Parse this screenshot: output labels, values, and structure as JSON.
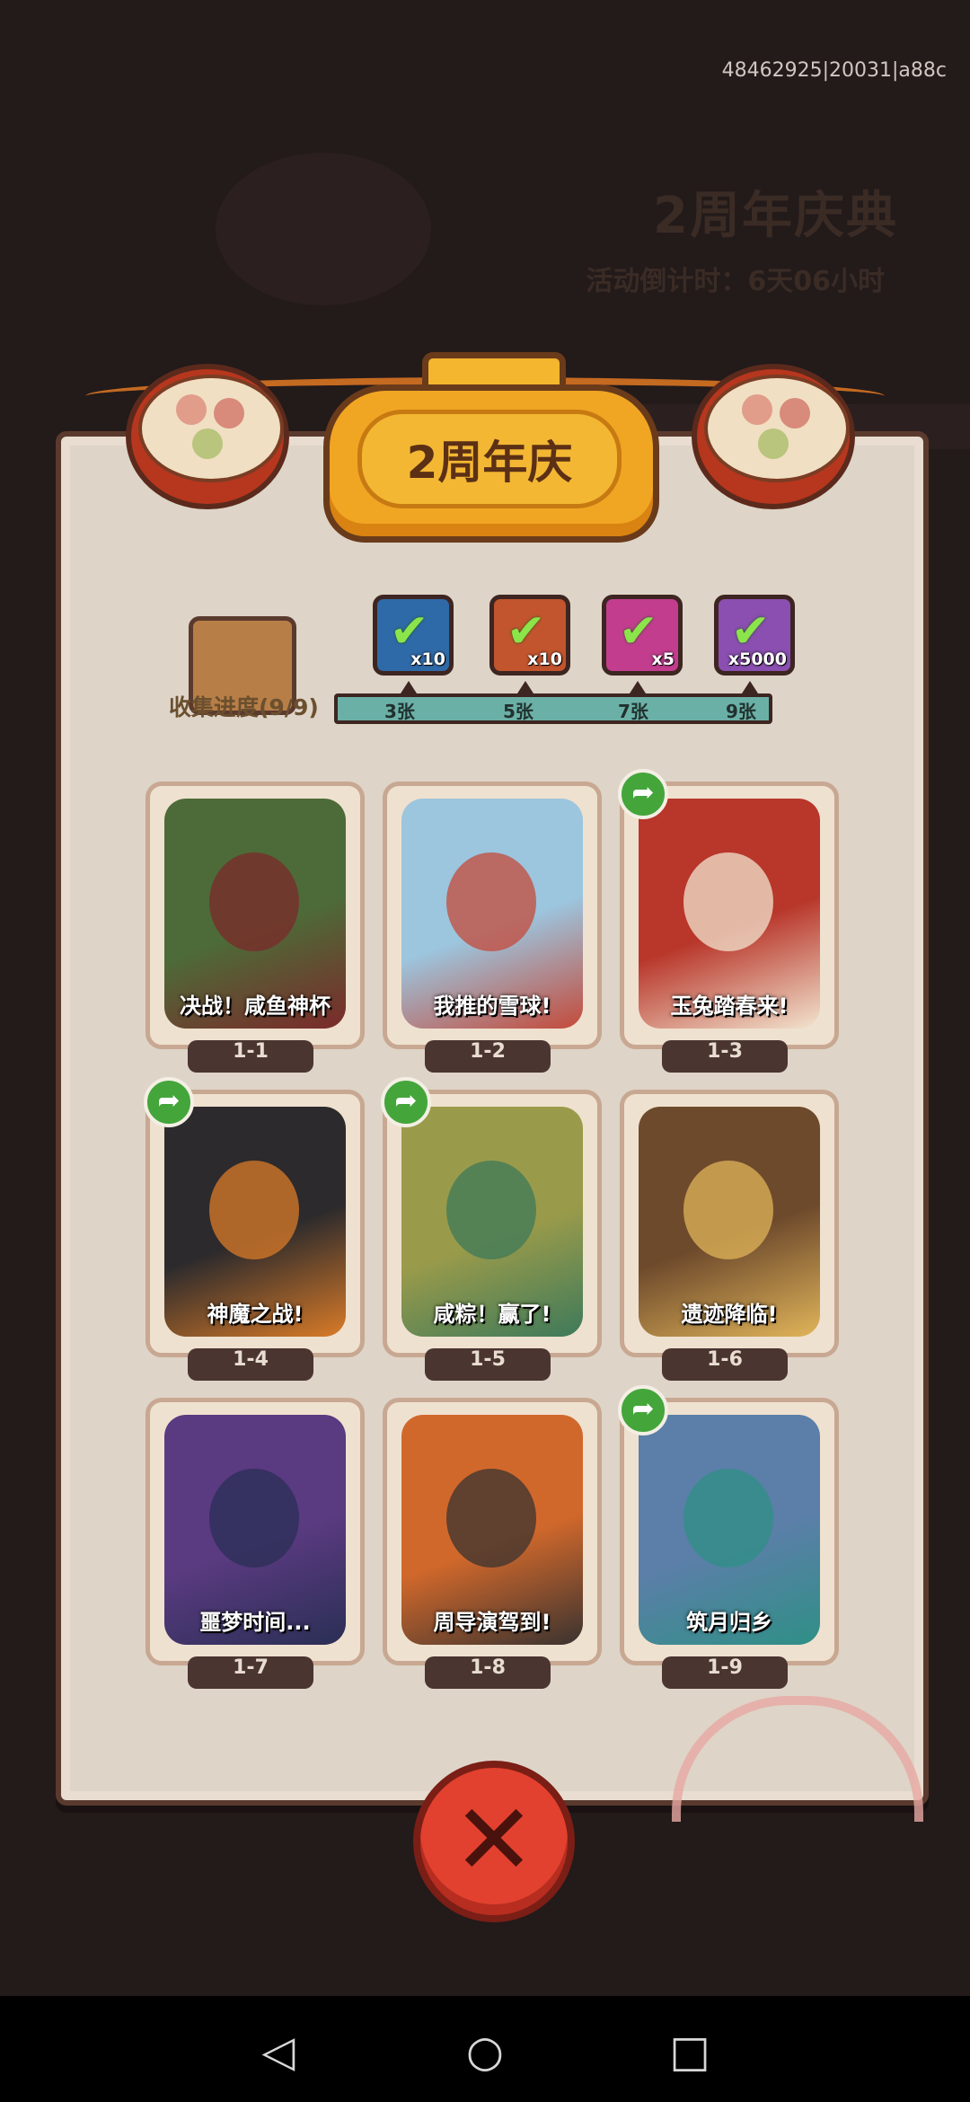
{
  "build_id": "48462925|20031|a88c",
  "background": {
    "event_title": "2周年庆典",
    "countdown": "活动倒计时：6天06小时"
  },
  "header": {
    "title": "2周年庆"
  },
  "collection": {
    "progress_label": "收集进度(9/9)",
    "collected": 9,
    "total": 9,
    "milestones": [
      {
        "threshold_label": "3张",
        "reward_icon": "treasure-chest-icon",
        "quantity": "x10",
        "color": "#2f6aa8"
      },
      {
        "threshold_label": "5张",
        "reward_icon": "golden-key-icon",
        "quantity": "x10",
        "color": "#c2552e"
      },
      {
        "threshold_label": "7张",
        "reward_icon": "magic-orb-icon",
        "quantity": "x5",
        "color": "#c33d8f"
      },
      {
        "threshold_label": "9张",
        "reward_icon": "silver-ingot-icon",
        "quantity": "x5000",
        "color": "#8a4fb0"
      }
    ]
  },
  "cards": [
    {
      "id": "1-1",
      "caption": "决战！咸鱼神杯",
      "shared": false,
      "colors": [
        "#4d6b38",
        "#7b2a2a"
      ]
    },
    {
      "id": "1-2",
      "caption": "我推的雪球!",
      "shared": false,
      "colors": [
        "#9cc5de",
        "#c44a3a"
      ]
    },
    {
      "id": "1-3",
      "caption": "玉兔踏春来!",
      "shared": true,
      "colors": [
        "#b8362a",
        "#f2e4cf"
      ]
    },
    {
      "id": "1-4",
      "caption": "神魔之战!",
      "shared": true,
      "colors": [
        "#2c2a2c",
        "#d97b28"
      ]
    },
    {
      "id": "1-5",
      "caption": "咸粽！赢了!",
      "shared": true,
      "colors": [
        "#9a9b4a",
        "#3e7a5a"
      ]
    },
    {
      "id": "1-6",
      "caption": "遗迹降临!",
      "shared": false,
      "colors": [
        "#6e4a2c",
        "#e0b45a"
      ]
    },
    {
      "id": "1-7",
      "caption": "噩梦时间...",
      "shared": false,
      "colors": [
        "#5a3a80",
        "#2a2f55"
      ]
    },
    {
      "id": "1-8",
      "caption": "周导演驾到!",
      "shared": false,
      "colors": [
        "#d1682b",
        "#3a3330"
      ]
    },
    {
      "id": "1-9",
      "caption": "筑月归乡",
      "shared": true,
      "colors": [
        "#5b7fa8",
        "#2f8f86"
      ]
    }
  ],
  "close_label": "✕",
  "navbar": {
    "back_icon": "◁",
    "home_icon": "○",
    "recent_icon": "□"
  }
}
